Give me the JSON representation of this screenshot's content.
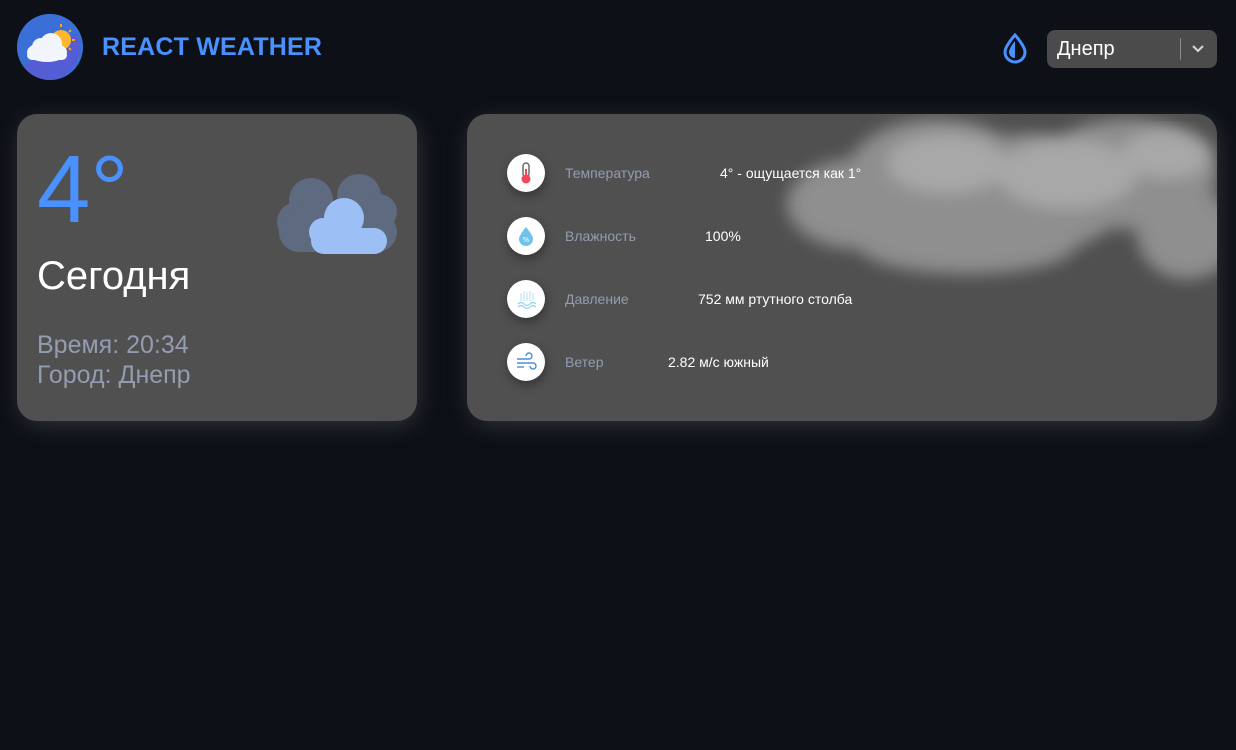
{
  "header": {
    "app_title": "REACT WEATHER",
    "logo_icon": "cloud-sun-logo-icon",
    "theme_icon": "drop-icon",
    "city_select": {
      "value": "Днепр",
      "arrow_icon": "chevron-down-icon"
    }
  },
  "today": {
    "temperature": "4°",
    "day_label": "Сегодня",
    "time_label": "Время: 20:34",
    "city_label": "Город: Днепр",
    "weather_icon": "cloudy-icon"
  },
  "details": [
    {
      "icon": "thermometer-icon",
      "label": "Температура",
      "value": "4° - ощущается как 1°"
    },
    {
      "icon": "humidity-drop-icon",
      "label": "Влажность",
      "value": "100%"
    },
    {
      "icon": "pressure-icon",
      "label": "Давление",
      "value": "752 мм ртутного столба"
    },
    {
      "icon": "wind-icon",
      "label": "Ветер",
      "value": "2.82 м/с южный"
    }
  ],
  "colors": {
    "background": "#0d1017",
    "card": "#505050",
    "accent": "#4891ff",
    "muted_text": "#939cb0"
  }
}
